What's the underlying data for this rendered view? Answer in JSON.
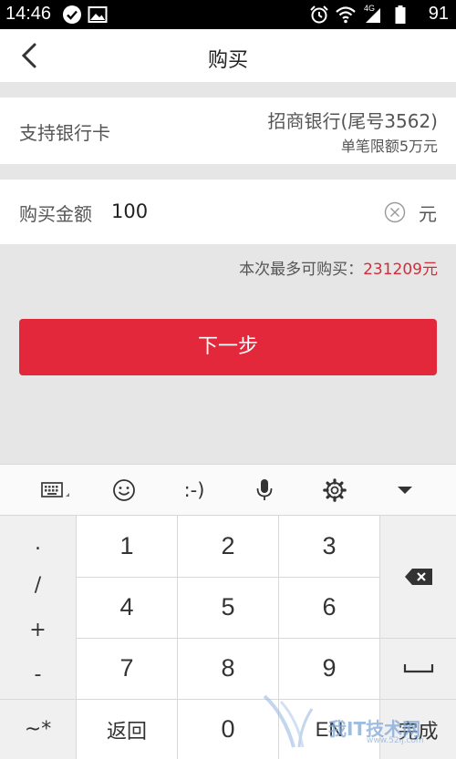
{
  "status_bar": {
    "time": "14:46",
    "network_label": "4G",
    "battery": "91"
  },
  "header": {
    "title": "购买"
  },
  "bank_card": {
    "label": "支持银行卡",
    "bank_name": "招商银行(尾号3562)",
    "limit": "单笔限额5万元"
  },
  "amount": {
    "label": "购买金额",
    "value": "100",
    "unit": "元"
  },
  "max_purchase": {
    "prefix": "本次最多可购买：",
    "value": "231209元"
  },
  "next_button": {
    "label": "下一步"
  },
  "keyboard_toolbar": {
    "emoticon_text": ":-)",
    "icons": [
      "keyboard-icon",
      "smiley-icon",
      "emoticon-text",
      "microphone-icon",
      "settings-icon",
      "collapse-icon"
    ]
  },
  "keyboard": {
    "symbols": [
      ".",
      "/",
      "+",
      "-"
    ],
    "tilde_key": "~*",
    "digits": [
      "1",
      "2",
      "3",
      "4",
      "5",
      "6",
      "7",
      "8",
      "9"
    ],
    "back_key": "返回",
    "zero_key": "0",
    "lang_key": "EN",
    "done_key": "完成"
  },
  "watermark": {
    "text": "我IT技术网",
    "url": "www.52ij.com"
  },
  "colors": {
    "accent": "#e2283a",
    "highlight_text": "#d42c3a",
    "background": "#e6e6e6"
  }
}
